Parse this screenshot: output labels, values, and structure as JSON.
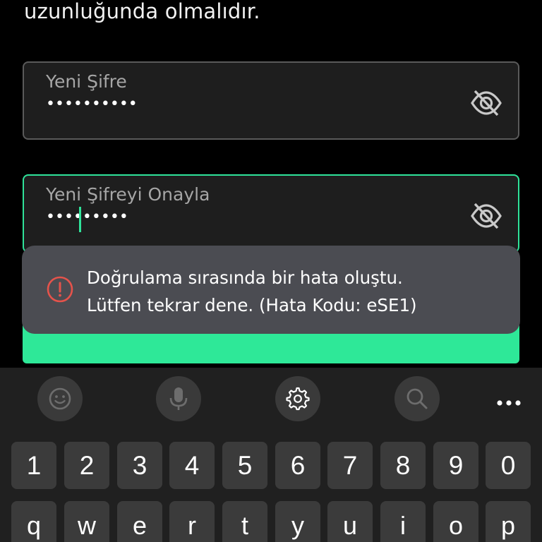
{
  "header": {
    "text_tail": "uzunluğunda olmalıdır."
  },
  "form": {
    "new_password": {
      "label": "Yeni Şifre",
      "value": "••••••••••",
      "toggle_icon": "eye-off-icon"
    },
    "confirm_password": {
      "label": "Yeni Şifreyi Onayla",
      "value": "•••••••••",
      "toggle_icon": "eye-off-icon"
    },
    "accent_color": "#2fe39a"
  },
  "toast": {
    "icon": "error-icon",
    "message": "Doğrulama sırasında bir hata oluştu.\nLütfen tekrar dene. (Hata Kodu: eSE1)",
    "error_color": "#e5534b"
  },
  "keyboard": {
    "toolbar": [
      "emoji-icon",
      "microphone-icon",
      "settings-icon",
      "search-icon",
      "more-icon"
    ],
    "number_row": [
      "1",
      "2",
      "3",
      "4",
      "5",
      "6",
      "7",
      "8",
      "9",
      "0"
    ],
    "letter_row": [
      "q",
      "w",
      "e",
      "r",
      "t",
      "y",
      "u",
      "i",
      "o",
      "p"
    ]
  }
}
